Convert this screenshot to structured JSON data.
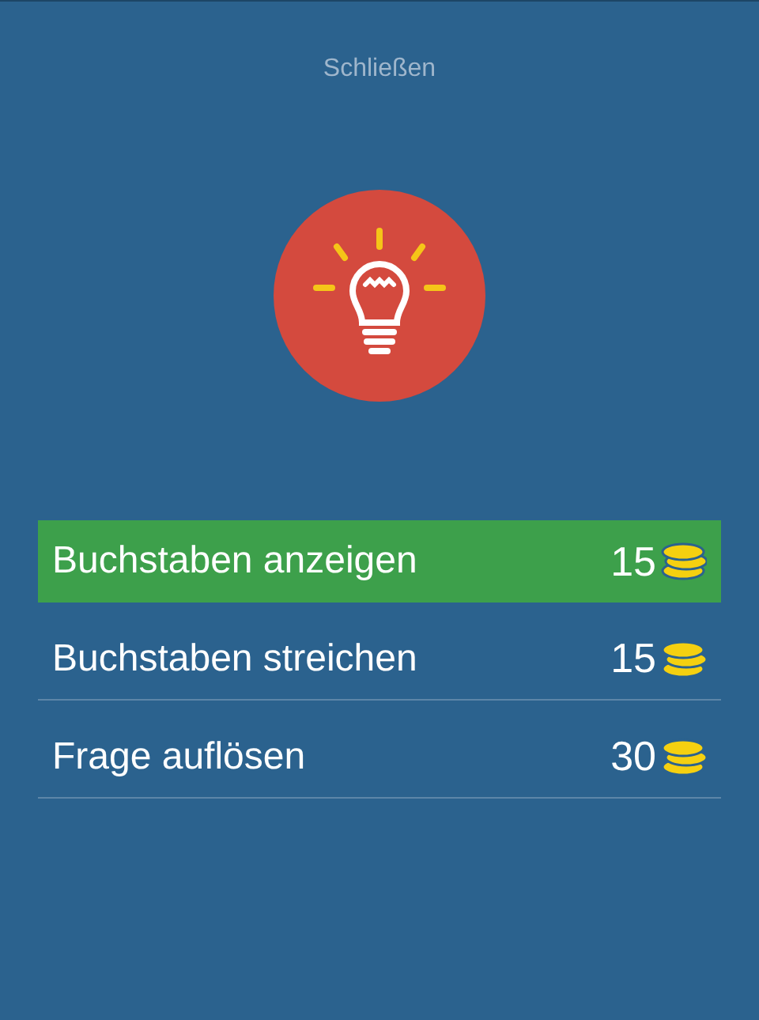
{
  "close_link": "Schließen",
  "options": [
    {
      "label": "Buchstaben anzeigen",
      "cost": "15",
      "selected": true
    },
    {
      "label": "Buchstaben streichen",
      "cost": "15",
      "selected": false
    },
    {
      "label": "Frage auflösen",
      "cost": "30",
      "selected": false
    }
  ]
}
